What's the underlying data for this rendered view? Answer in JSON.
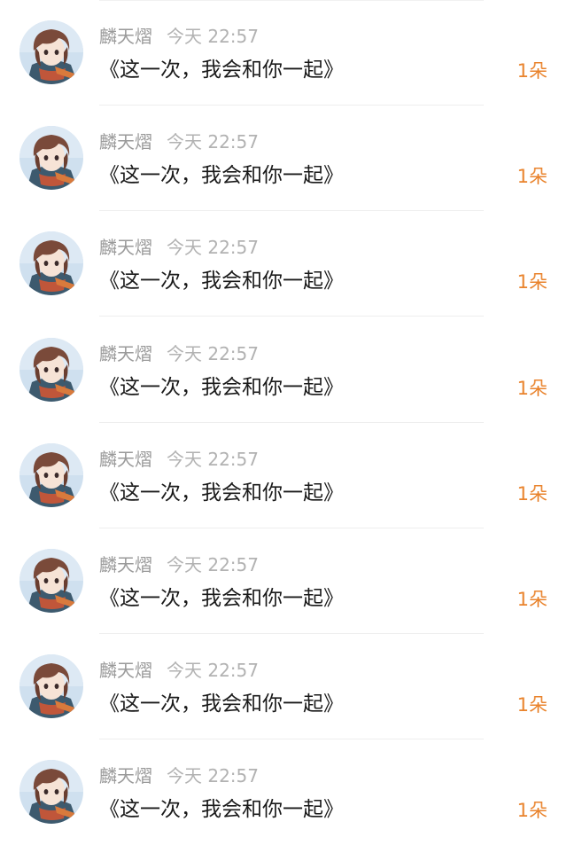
{
  "items": [
    {
      "name": "麟天熠",
      "time": "今天 22:57",
      "title": "《这一次，我会和你一起》",
      "count": "1朵"
    },
    {
      "name": "麟天熠",
      "time": "今天 22:57",
      "title": "《这一次，我会和你一起》",
      "count": "1朵"
    },
    {
      "name": "麟天熠",
      "time": "今天 22:57",
      "title": "《这一次，我会和你一起》",
      "count": "1朵"
    },
    {
      "name": "麟天熠",
      "time": "今天 22:57",
      "title": "《这一次，我会和你一起》",
      "count": "1朵"
    },
    {
      "name": "麟天熠",
      "time": "今天 22:57",
      "title": "《这一次，我会和你一起》",
      "count": "1朵"
    },
    {
      "name": "麟天熠",
      "time": "今天 22:57",
      "title": "《这一次，我会和你一起》",
      "count": "1朵"
    },
    {
      "name": "麟天熠",
      "time": "今天 22:57",
      "title": "《这一次，我会和你一起》",
      "count": "1朵"
    },
    {
      "name": "麟天熠",
      "time": "今天 22:57",
      "title": "《这一次，我会和你一起》",
      "count": "1朵"
    }
  ],
  "colors": {
    "name": "#9a9a9a",
    "time": "#b2b2b2",
    "title": "#1a1a1a",
    "count": "#e9832c",
    "divider": "#eeeeee"
  }
}
